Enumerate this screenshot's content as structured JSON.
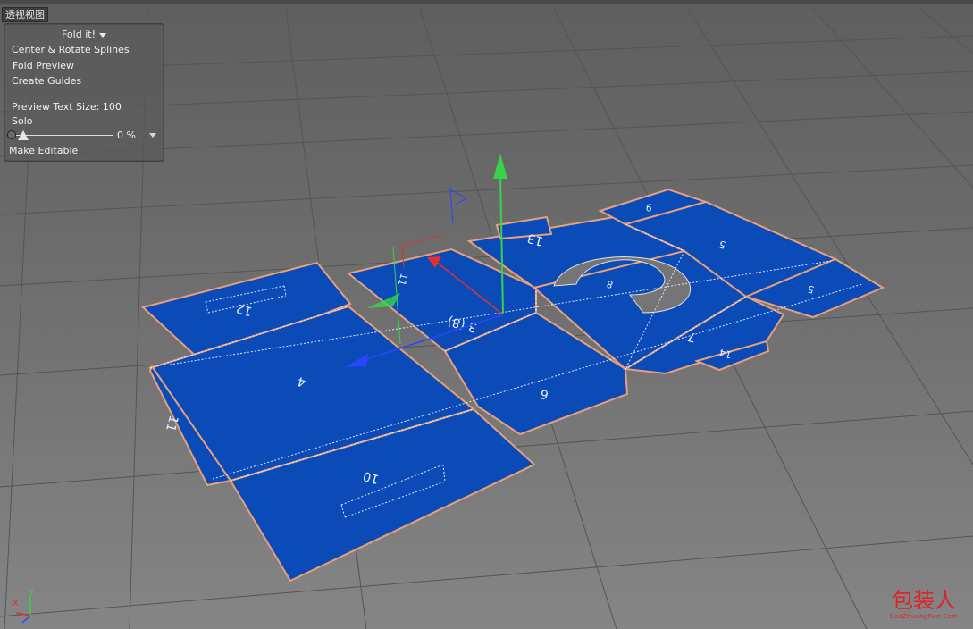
{
  "viewport": {
    "label": "透视视图"
  },
  "hud": {
    "title": "Fold it!",
    "items": [
      "Center & Rotate Splines",
      "Fold Preview",
      "Create Guides",
      "Preview Text Size:   100",
      "Solo",
      "Make Editable"
    ],
    "slider_value": "0 %",
    "slider_percent": 0
  },
  "scene": {
    "panel_labels": [
      "12",
      "4",
      "10",
      "11",
      "3 (8)",
      "6",
      "13",
      "8",
      "7",
      "14",
      "9",
      "5",
      "5",
      "11"
    ],
    "colors": {
      "background": "#6e6e6e",
      "grid": "#555555",
      "panel": "#0a4bb7",
      "panel_edge": "#e8a07a",
      "fold_lines": "#dfe8ff",
      "axis_x": "#e23030",
      "axis_y": "#39d24a",
      "axis_z": "#2b45ff"
    }
  },
  "axis": {
    "x": "X",
    "y": "Y"
  },
  "watermark": {
    "main": "包装人",
    "sub": "BaoZhuangRen.Com"
  }
}
